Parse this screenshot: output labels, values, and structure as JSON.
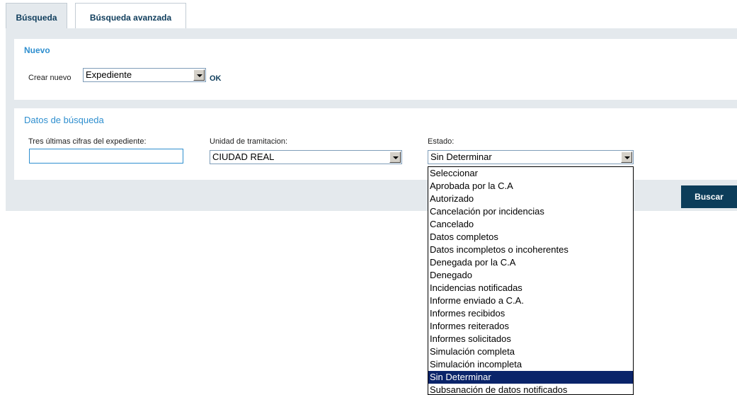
{
  "tabs": [
    {
      "label": "Búsqueda",
      "active": true
    },
    {
      "label": "Búsqueda avanzada",
      "active": false
    }
  ],
  "nuevo": {
    "title": "Nuevo",
    "create_label": "Crear nuevo",
    "select_value": "Expediente",
    "ok_label": "OK"
  },
  "datos": {
    "title": "Datos de búsqueda",
    "expediente_label": "Tres últimas cifras del expediente:",
    "expediente_value": "",
    "unidad_label": "Unidad de tramitacion:",
    "unidad_value": "CIUDAD REAL",
    "estado_label": "Estado:",
    "estado_value": "Sin Determinar",
    "estado_options": [
      "Seleccionar",
      "Aprobada por la C.A",
      "Autorizado",
      "Cancelación por incidencias",
      "Cancelado",
      "Datos completos",
      "Datos incompletos o incoherentes",
      "Denegada por la C.A",
      "Denegado",
      "Incidencias notificadas",
      "Informe enviado a C.A.",
      "Informes recibidos",
      "Informes reiterados",
      "Informes solicitados",
      "Simulación completa",
      "Simulación incompleta",
      "Sin Determinar",
      "Subsanación de datos notificados"
    ],
    "estado_selected_index": 16
  },
  "search_button_label": "Buscar",
  "colors": {
    "accent": "#2f8fcf",
    "panel_bg": "#e4e9ed",
    "button_bg": "#0c3d5a",
    "selected_option_bg": "#0a246a"
  }
}
